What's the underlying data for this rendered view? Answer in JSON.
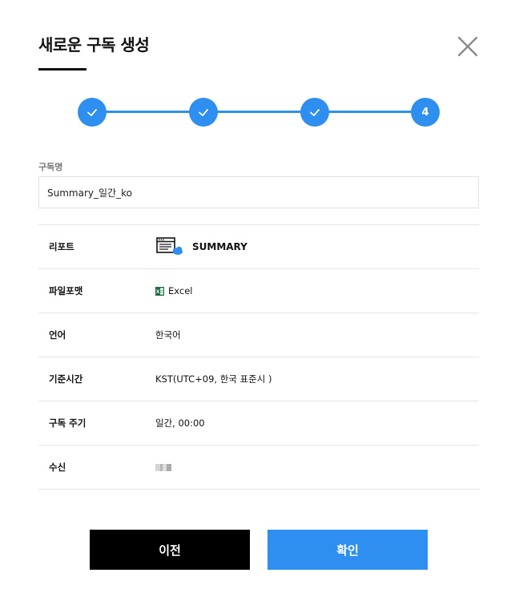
{
  "header": {
    "title": "새로운 구독 생성"
  },
  "stepper": {
    "current_step": "4",
    "completed_steps": 3,
    "total_steps": 4
  },
  "form": {
    "name_label": "구독명",
    "name_value": "Summary_일간_ko"
  },
  "details": {
    "report_label": "리포트",
    "report_value": "SUMMARY",
    "format_label": "파일포맷",
    "format_value": "Excel",
    "language_label": "언어",
    "language_value": "한국어",
    "timezone_label": "기준시간",
    "timezone_value": "KST(UTC+09, 한국 표준시 )",
    "cycle_label": "구독 주기",
    "cycle_value": "일간, 00:00",
    "recipient_label": "수신"
  },
  "buttons": {
    "prev": "이전",
    "confirm": "확인"
  },
  "colors": {
    "accent": "#2f8ff0",
    "primary_button": "#000000",
    "excel_green": "#1d6f42"
  }
}
